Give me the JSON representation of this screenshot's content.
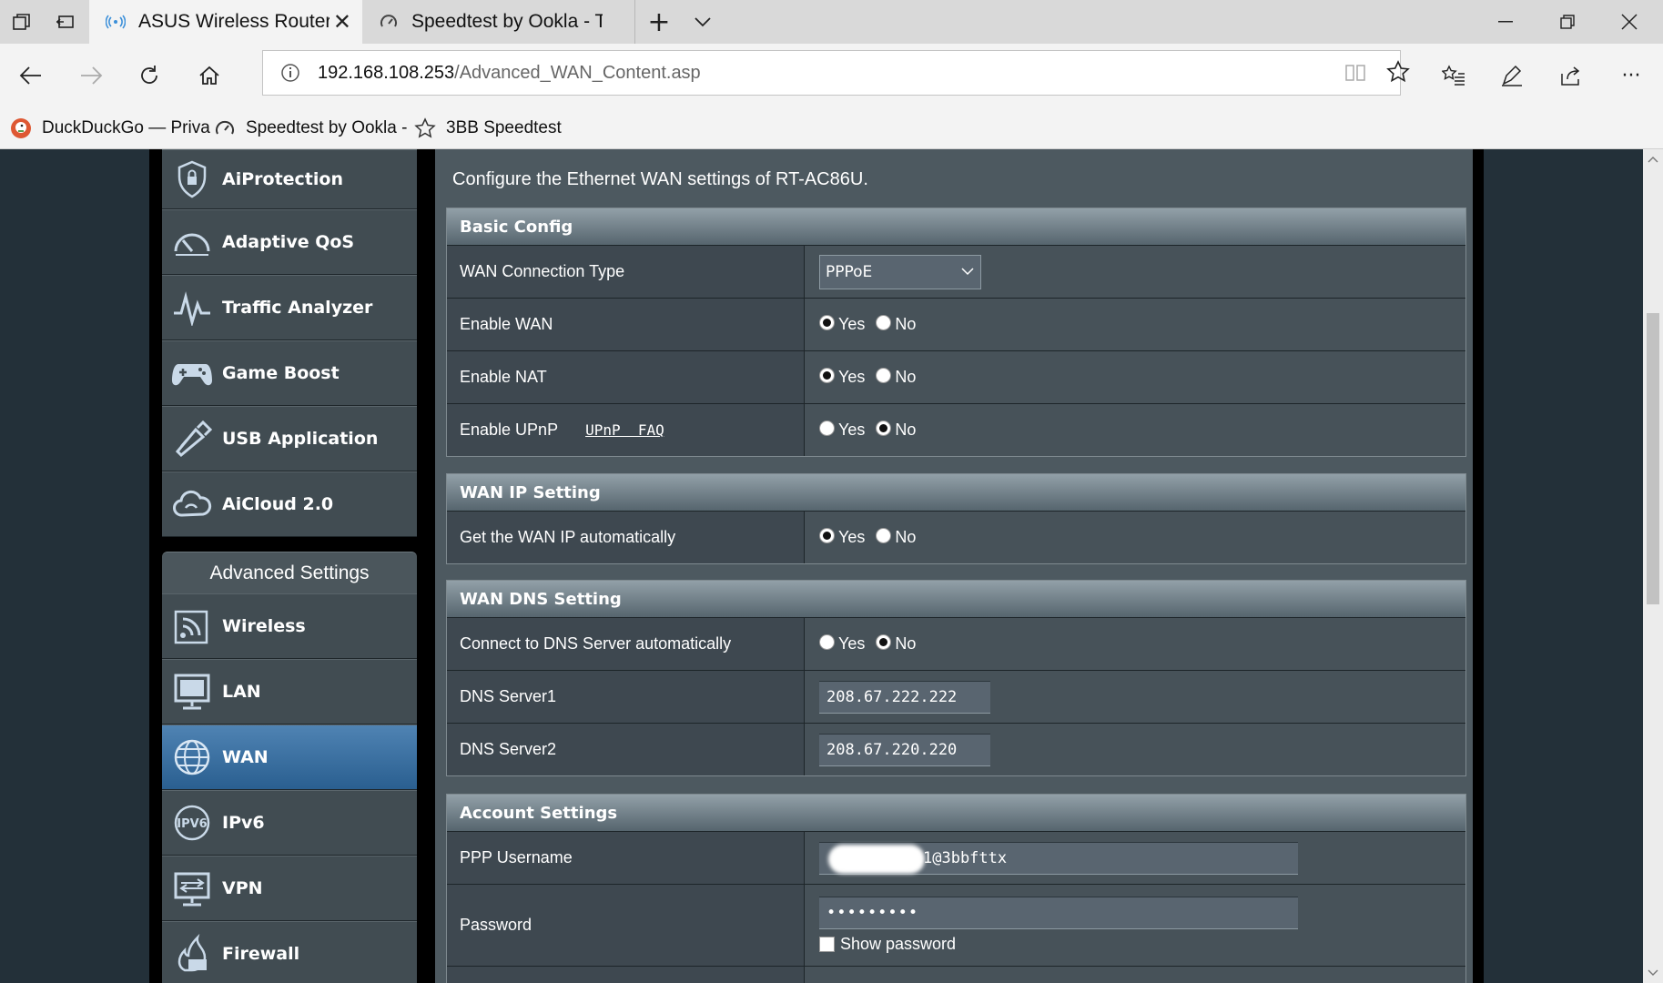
{
  "browser": {
    "tabs": [
      {
        "title": "ASUS Wireless Router R"
      },
      {
        "title": "Speedtest by Ookla - The G"
      }
    ],
    "url_host": "192.168.108.253",
    "url_path": "/Advanced_WAN_Content.asp",
    "bookmarks": [
      {
        "label": "DuckDuckGo — Priva"
      },
      {
        "label": "Speedtest by Ookla -"
      },
      {
        "label": "3BB Speedtest"
      }
    ]
  },
  "menu": {
    "general": [
      {
        "label": "AiProtection",
        "icon": "shield-icon"
      },
      {
        "label": "Adaptive QoS",
        "icon": "speedometer-icon"
      },
      {
        "label": "Traffic Analyzer",
        "icon": "pulse-icon"
      },
      {
        "label": "Game Boost",
        "icon": "gamepad-icon"
      },
      {
        "label": "USB Application",
        "icon": "usb-icon"
      },
      {
        "label": "AiCloud 2.0",
        "icon": "cloud-icon"
      }
    ],
    "advanced_heading": "Advanced Settings",
    "advanced": [
      {
        "label": "Wireless",
        "icon": "wifi-icon"
      },
      {
        "label": "LAN",
        "icon": "monitor-icon"
      },
      {
        "label": "WAN",
        "icon": "globe-icon",
        "active": true
      },
      {
        "label": "IPv6",
        "icon": "ipv6-globe-icon"
      },
      {
        "label": "VPN",
        "icon": "vpn-icon"
      },
      {
        "label": "Firewall",
        "icon": "firewall-icon"
      }
    ]
  },
  "content": {
    "intro": "Configure the Ethernet WAN settings of RT-AC86U.",
    "yes": "Yes",
    "no": "No",
    "basic": {
      "title": "Basic Config",
      "wan_type_label": "WAN Connection Type",
      "wan_type_value": "PPPoE",
      "enable_wan_label": "Enable WAN",
      "enable_nat_label": "Enable NAT",
      "enable_upnp_label": "Enable UPnP",
      "upnp_faq": "UPnP  FAQ"
    },
    "wanip": {
      "title": "WAN IP Setting",
      "auto_label": "Get the WAN IP automatically"
    },
    "dns": {
      "title": "WAN DNS Setting",
      "auto_label": "Connect to DNS Server automatically",
      "dns1_label": "DNS Server1",
      "dns1_value": "208.67.222.222",
      "dns2_label": "DNS Server2",
      "dns2_value": "208.67.220.220"
    },
    "account": {
      "title": "Account Settings",
      "username_label": "PPP Username",
      "username_value": "1@3bbfttx",
      "password_label": "Password",
      "password_value": "•••••••••",
      "show_password": "Show password"
    }
  }
}
